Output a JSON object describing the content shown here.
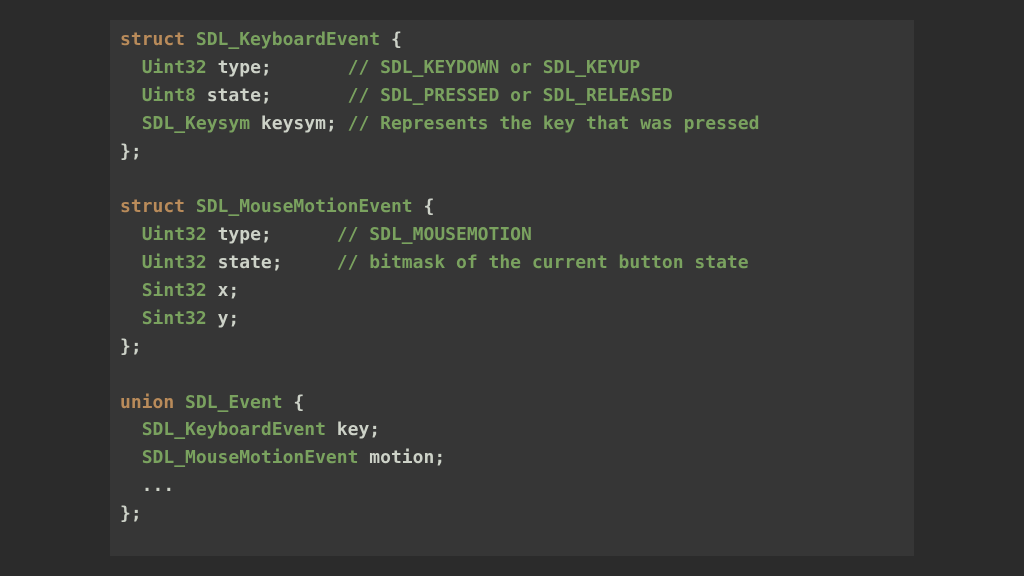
{
  "tokens": [
    [
      {
        "t": "struct",
        "c": "kw"
      },
      {
        "t": " ",
        "c": "punc"
      },
      {
        "t": "SDL_KeyboardEvent",
        "c": "type"
      },
      {
        "t": " {",
        "c": "punc"
      }
    ],
    [
      {
        "t": "  ",
        "c": "punc"
      },
      {
        "t": "Uint32",
        "c": "type"
      },
      {
        "t": " ",
        "c": "punc"
      },
      {
        "t": "type",
        "c": "ident"
      },
      {
        "t": ";       ",
        "c": "punc"
      },
      {
        "t": "// SDL_KEYDOWN or SDL_KEYUP",
        "c": "cmt"
      }
    ],
    [
      {
        "t": "  ",
        "c": "punc"
      },
      {
        "t": "Uint8",
        "c": "type"
      },
      {
        "t": " ",
        "c": "punc"
      },
      {
        "t": "state",
        "c": "ident"
      },
      {
        "t": ";       ",
        "c": "punc"
      },
      {
        "t": "// SDL_PRESSED or SDL_RELEASED",
        "c": "cmt"
      }
    ],
    [
      {
        "t": "  ",
        "c": "punc"
      },
      {
        "t": "SDL_Keysym",
        "c": "type"
      },
      {
        "t": " ",
        "c": "punc"
      },
      {
        "t": "keysym",
        "c": "ident"
      },
      {
        "t": "; ",
        "c": "punc"
      },
      {
        "t": "// Represents the key that was pressed",
        "c": "cmt"
      }
    ],
    [
      {
        "t": "};",
        "c": "punc"
      }
    ],
    [],
    [
      {
        "t": "struct",
        "c": "kw"
      },
      {
        "t": " ",
        "c": "punc"
      },
      {
        "t": "SDL_MouseMotionEvent",
        "c": "type"
      },
      {
        "t": " {",
        "c": "punc"
      }
    ],
    [
      {
        "t": "  ",
        "c": "punc"
      },
      {
        "t": "Uint32",
        "c": "type"
      },
      {
        "t": " ",
        "c": "punc"
      },
      {
        "t": "type",
        "c": "ident"
      },
      {
        "t": ";      ",
        "c": "punc"
      },
      {
        "t": "// SDL_MOUSEMOTION",
        "c": "cmt"
      }
    ],
    [
      {
        "t": "  ",
        "c": "punc"
      },
      {
        "t": "Uint32",
        "c": "type"
      },
      {
        "t": " ",
        "c": "punc"
      },
      {
        "t": "state",
        "c": "ident"
      },
      {
        "t": ";     ",
        "c": "punc"
      },
      {
        "t": "// bitmask of the current button state",
        "c": "cmt"
      }
    ],
    [
      {
        "t": "  ",
        "c": "punc"
      },
      {
        "t": "Sint32",
        "c": "type"
      },
      {
        "t": " ",
        "c": "punc"
      },
      {
        "t": "x",
        "c": "ident"
      },
      {
        "t": ";",
        "c": "punc"
      }
    ],
    [
      {
        "t": "  ",
        "c": "punc"
      },
      {
        "t": "Sint32",
        "c": "type"
      },
      {
        "t": " ",
        "c": "punc"
      },
      {
        "t": "y",
        "c": "ident"
      },
      {
        "t": ";",
        "c": "punc"
      }
    ],
    [
      {
        "t": "};",
        "c": "punc"
      }
    ],
    [],
    [
      {
        "t": "union",
        "c": "kw"
      },
      {
        "t": " ",
        "c": "punc"
      },
      {
        "t": "SDL_Event",
        "c": "type"
      },
      {
        "t": " {",
        "c": "punc"
      }
    ],
    [
      {
        "t": "  ",
        "c": "punc"
      },
      {
        "t": "SDL_KeyboardEvent",
        "c": "type"
      },
      {
        "t": " ",
        "c": "punc"
      },
      {
        "t": "key",
        "c": "ident"
      },
      {
        "t": ";",
        "c": "punc"
      }
    ],
    [
      {
        "t": "  ",
        "c": "punc"
      },
      {
        "t": "SDL_MouseMotionEvent",
        "c": "type"
      },
      {
        "t": " ",
        "c": "punc"
      },
      {
        "t": "motion",
        "c": "ident"
      },
      {
        "t": ";",
        "c": "punc"
      }
    ],
    [
      {
        "t": "  ...",
        "c": "punc"
      }
    ],
    [
      {
        "t": "};",
        "c": "punc"
      }
    ]
  ]
}
